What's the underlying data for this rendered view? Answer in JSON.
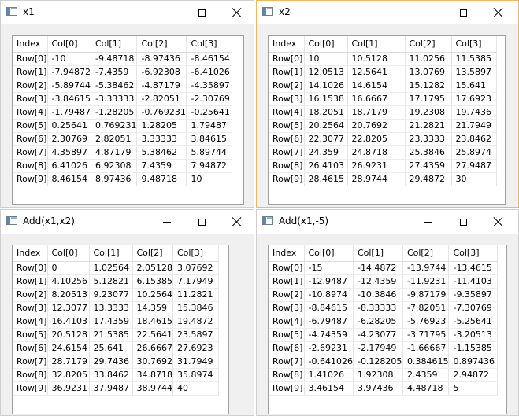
{
  "columns": [
    "Index",
    "Col[0]",
    "Col[1]",
    "Col[2]",
    "Col[3]"
  ],
  "row_labels": [
    "Row[0]",
    "Row[1]",
    "Row[2]",
    "Row[3]",
    "Row[4]",
    "Row[5]",
    "Row[6]",
    "Row[7]",
    "Row[8]",
    "Row[9]"
  ],
  "windows": [
    {
      "title": "x1",
      "rows": [
        [
          "-10",
          "-9.48718",
          "-8.97436",
          "-8.46154"
        ],
        [
          "-7.94872",
          "-7.4359",
          "-6.92308",
          "-6.41026"
        ],
        [
          "-5.89744",
          "-5.38462",
          "-4.87179",
          "-4.35897"
        ],
        [
          "-3.84615",
          "-3.33333",
          "-2.82051",
          "-2.30769"
        ],
        [
          "-1.79487",
          "-1.28205",
          "-0.769231",
          "-0.25641"
        ],
        [
          "0.25641",
          "0.769231",
          "1.28205",
          "1.79487"
        ],
        [
          "2.30769",
          "2.82051",
          "3.33333",
          "3.84615"
        ],
        [
          "4.35897",
          "4.87179",
          "5.38462",
          "5.89744"
        ],
        [
          "6.41026",
          "6.92308",
          "7.4359",
          "7.94872"
        ],
        [
          "8.46154",
          "8.97436",
          "9.48718",
          "10"
        ]
      ]
    },
    {
      "title": "x2",
      "rows": [
        [
          "10",
          "10.5128",
          "11.0256",
          "11.5385"
        ],
        [
          "12.0513",
          "12.5641",
          "13.0769",
          "13.5897"
        ],
        [
          "14.1026",
          "14.6154",
          "15.1282",
          "15.641"
        ],
        [
          "16.1538",
          "16.6667",
          "17.1795",
          "17.6923"
        ],
        [
          "18.2051",
          "18.7179",
          "19.2308",
          "19.7436"
        ],
        [
          "20.2564",
          "20.7692",
          "21.2821",
          "21.7949"
        ],
        [
          "22.3077",
          "22.8205",
          "23.3333",
          "23.8462"
        ],
        [
          "24.359",
          "24.8718",
          "25.3846",
          "25.8974"
        ],
        [
          "26.4103",
          "26.9231",
          "27.4359",
          "27.9487"
        ],
        [
          "28.4615",
          "28.9744",
          "29.4872",
          "30"
        ]
      ]
    },
    {
      "title": "Add(x1,x2)",
      "rows": [
        [
          "0",
          "1.02564",
          "2.05128",
          "3.07692"
        ],
        [
          "4.10256",
          "5.12821",
          "6.15385",
          "7.17949"
        ],
        [
          "8.20513",
          "9.23077",
          "10.2564",
          "11.2821"
        ],
        [
          "12.3077",
          "13.3333",
          "14.359",
          "15.3846"
        ],
        [
          "16.4103",
          "17.4359",
          "18.4615",
          "19.4872"
        ],
        [
          "20.5128",
          "21.5385",
          "22.5641",
          "23.5897"
        ],
        [
          "24.6154",
          "25.641",
          "26.6667",
          "27.6923"
        ],
        [
          "28.7179",
          "29.7436",
          "30.7692",
          "31.7949"
        ],
        [
          "32.8205",
          "33.8462",
          "34.8718",
          "35.8974"
        ],
        [
          "36.9231",
          "37.9487",
          "38.9744",
          "40"
        ]
      ]
    },
    {
      "title": "Add(x1,-5)",
      "rows": [
        [
          "-15",
          "-14.4872",
          "-13.9744",
          "-13.4615"
        ],
        [
          "-12.9487",
          "-12.4359",
          "-11.9231",
          "-11.4103"
        ],
        [
          "-10.8974",
          "-10.3846",
          "-9.87179",
          "-9.35897"
        ],
        [
          "-8.84615",
          "-8.33333",
          "-7.82051",
          "-7.30769"
        ],
        [
          "-6.79487",
          "-6.28205",
          "-5.76923",
          "-5.25641"
        ],
        [
          "-4.74359",
          "-4.23077",
          "-3.71795",
          "-3.20513"
        ],
        [
          "-2.69231",
          "-2.17949",
          "-1.66667",
          "-1.15385"
        ],
        [
          "-0.641026",
          "-0.128205",
          "0.384615",
          "0.897436"
        ],
        [
          "1.41026",
          "1.92308",
          "2.4359",
          "2.94872"
        ],
        [
          "3.46154",
          "3.97436",
          "4.48718",
          "5"
        ]
      ]
    }
  ]
}
